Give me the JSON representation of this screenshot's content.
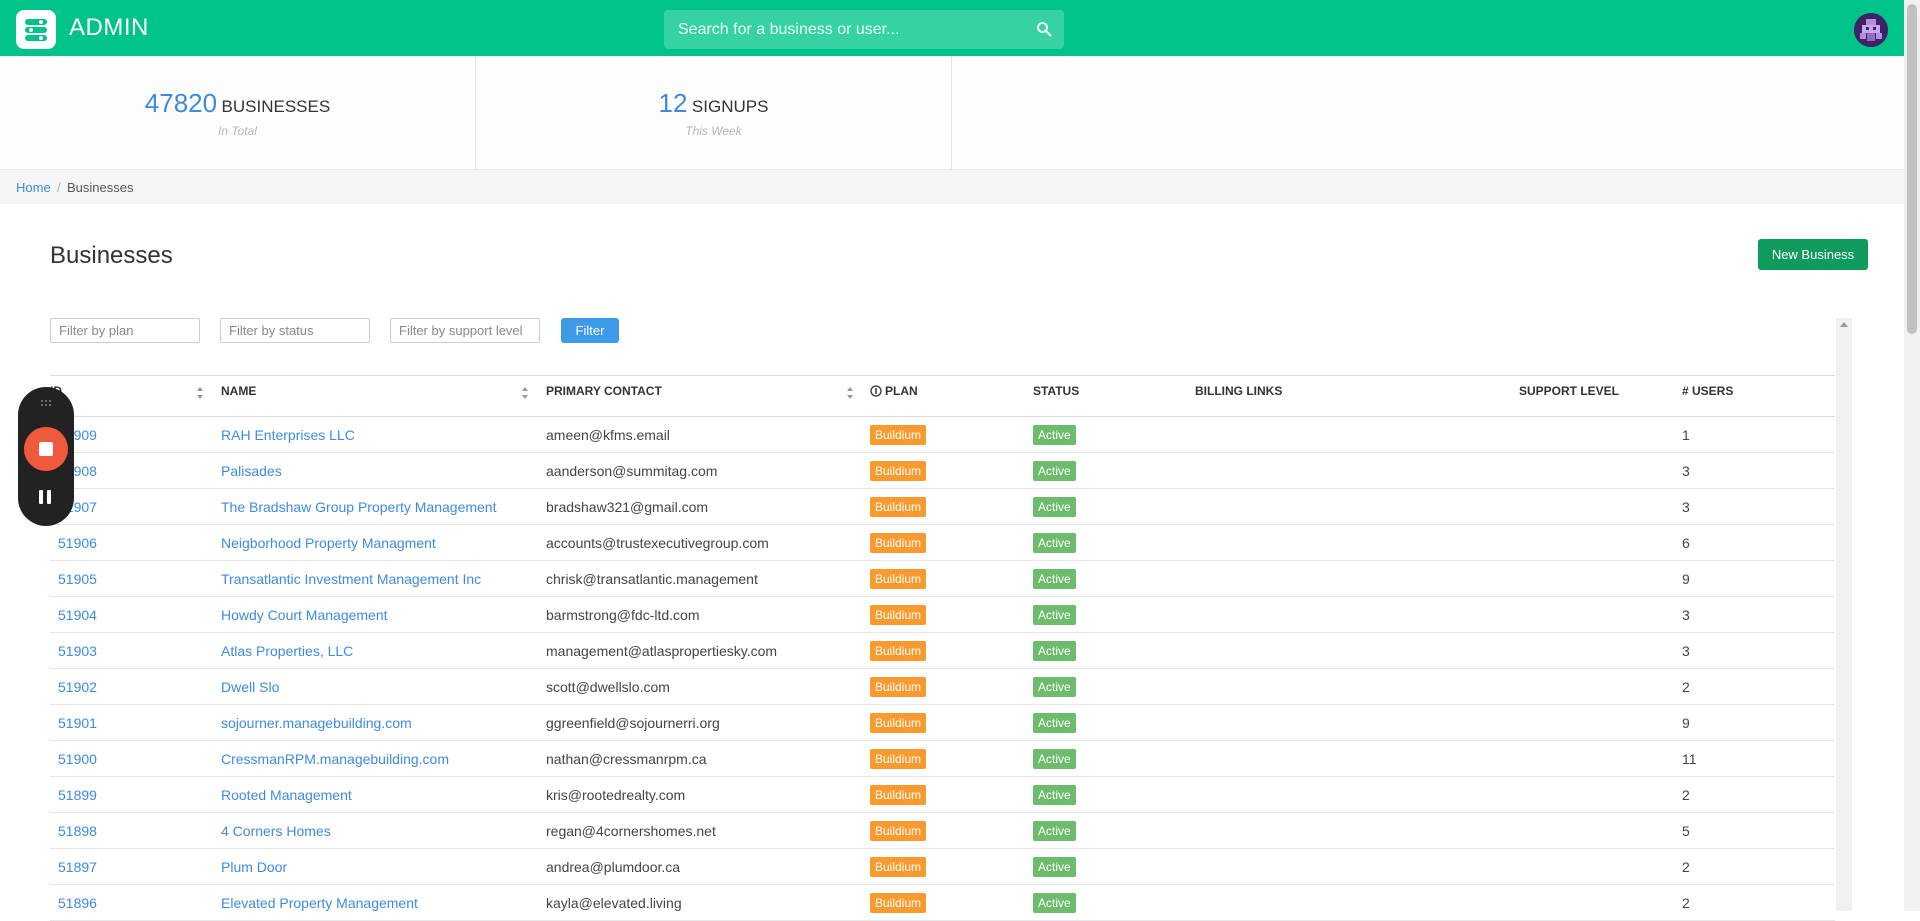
{
  "header": {
    "app_title": "ADMIN",
    "search_placeholder": "Search for a business or user...",
    "accent_color": "#00c389"
  },
  "stats": [
    {
      "value": "47820",
      "label": "BUSINESSES",
      "sub": "In Total"
    },
    {
      "value": "12",
      "label": "SIGNUPS",
      "sub": "This Week"
    }
  ],
  "breadcrumb": {
    "home": "Home",
    "separator": "/",
    "current": "Businesses"
  },
  "page": {
    "title": "Businesses",
    "new_button": "New Business"
  },
  "filters": {
    "plan_placeholder": "Filter by plan",
    "status_placeholder": "Filter by status",
    "support_placeholder": "Filter by support level",
    "button": "Filter"
  },
  "table": {
    "columns": [
      "ID",
      "NAME",
      "PRIMARY CONTACT",
      "PLAN",
      "STATUS",
      "BILLING LINKS",
      "SUPPORT LEVEL",
      "# USERS"
    ],
    "rows": [
      {
        "id": "51909",
        "name": "RAH Enterprises LLC",
        "contact": "ameen@kfms.email",
        "plan": "Buildium",
        "status": "Active",
        "users": "1"
      },
      {
        "id": "51908",
        "name": "Palisades",
        "contact": "aanderson@summitag.com",
        "plan": "Buildium",
        "status": "Active",
        "users": "3"
      },
      {
        "id": "51907",
        "name": "The Bradshaw Group Property Management",
        "contact": "bradshaw321@gmail.com",
        "plan": "Buildium",
        "status": "Active",
        "users": "3"
      },
      {
        "id": "51906",
        "name": "Neigborhood Property Managment",
        "contact": "accounts@trustexecutivegroup.com",
        "plan": "Buildium",
        "status": "Active",
        "users": "6"
      },
      {
        "id": "51905",
        "name": "Transatlantic Investment Management Inc",
        "contact": "chrisk@transatlantic.management",
        "plan": "Buildium",
        "status": "Active",
        "users": "9"
      },
      {
        "id": "51904",
        "name": "Howdy Court Management",
        "contact": "barmstrong@fdc-ltd.com",
        "plan": "Buildium",
        "status": "Active",
        "users": "3"
      },
      {
        "id": "51903",
        "name": "Atlas Properties, LLC",
        "contact": "management@atlaspropertiesky.com",
        "plan": "Buildium",
        "status": "Active",
        "users": "3"
      },
      {
        "id": "51902",
        "name": "Dwell Slo",
        "contact": "scott@dwellslo.com",
        "plan": "Buildium",
        "status": "Active",
        "users": "2"
      },
      {
        "id": "51901",
        "name": "sojourner.managebuilding.com",
        "contact": "ggreenfield@sojournerri.org",
        "plan": "Buildium",
        "status": "Active",
        "users": "9"
      },
      {
        "id": "51900",
        "name": "CressmanRPM.managebuilding.com",
        "contact": "nathan@cressmanrpm.ca",
        "plan": "Buildium",
        "status": "Active",
        "users": "11"
      },
      {
        "id": "51899",
        "name": "Rooted Management",
        "contact": "kris@rootedrealty.com",
        "plan": "Buildium",
        "status": "Active",
        "users": "2"
      },
      {
        "id": "51898",
        "name": "4 Corners Homes",
        "contact": "regan@4cornershomes.net",
        "plan": "Buildium",
        "status": "Active",
        "users": "5"
      },
      {
        "id": "51897",
        "name": "Plum Door",
        "contact": "andrea@plumdoor.ca",
        "plan": "Buildium",
        "status": "Active",
        "users": "2"
      },
      {
        "id": "51896",
        "name": "Elevated Property Management",
        "contact": "kayla@elevated.living",
        "plan": "Buildium",
        "status": "Active",
        "users": "2"
      }
    ]
  }
}
